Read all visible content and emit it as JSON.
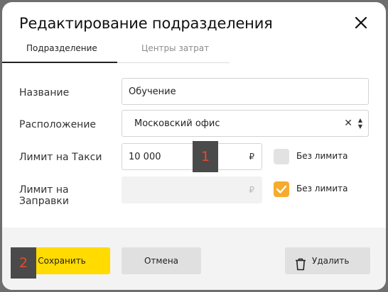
{
  "dialog": {
    "title": "Редактирование подразделения",
    "close_icon": "close-icon"
  },
  "tabs": [
    {
      "label": "Подразделение",
      "active": true
    },
    {
      "label": "Центры затрат",
      "active": false
    }
  ],
  "form": {
    "name": {
      "label": "Название",
      "value": "Обучение"
    },
    "location": {
      "label": "Расположение",
      "value": "Московский офис"
    },
    "taxi_limit": {
      "label": "Лимит на Такси",
      "value": "10 000",
      "currency": "₽",
      "no_limit_label": "Без лимита",
      "no_limit_checked": false
    },
    "fuel_limit": {
      "label_line1": "Лимит на",
      "label_line2": "Заправки",
      "value": "",
      "currency": "₽",
      "no_limit_label": "Без лимита",
      "no_limit_checked": true
    }
  },
  "annotations": {
    "marker_1": "1",
    "marker_2": "2"
  },
  "buttons": {
    "save": "Сохранить",
    "cancel": "Отмена",
    "delete": "Удалить"
  },
  "colors": {
    "accent": "#ffdb00",
    "checkbox_on": "#f6ab2e",
    "marker_text": "#e84a2e"
  }
}
